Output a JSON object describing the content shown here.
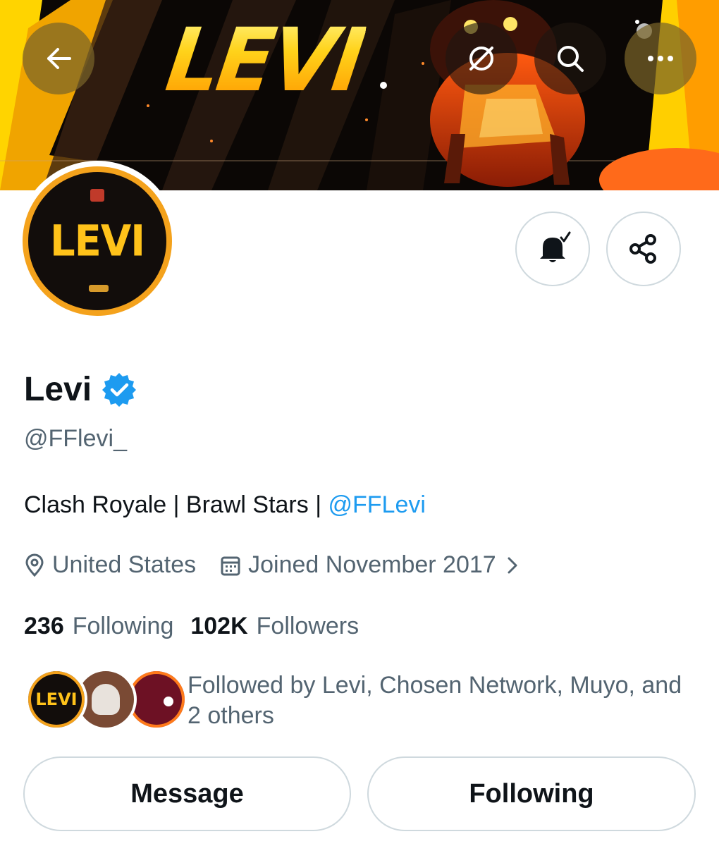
{
  "header": {
    "banner_text": "LEVI",
    "back_icon": "arrow-left-icon",
    "translate_icon": "globe-off-icon",
    "search_icon": "search-icon",
    "more_icon": "more-horizontal-icon"
  },
  "profile": {
    "avatar_text": "LEVI",
    "name": "Levi",
    "handle": "@FFlevi_",
    "bio_text": "Clash Royale | Brawl Stars | ",
    "bio_mention": "@FFLevi",
    "location": "United States",
    "joined": "Joined November 2017",
    "following_count": "236",
    "following_label": "Following",
    "followers_count": "102K",
    "followers_label": "Followers",
    "followed_by_text": "Followed by Levi, Chosen Network, Muyo, and 2 others",
    "followed_avatar_text": "LEVI"
  },
  "actions": {
    "message_label": "Message",
    "following_label": "Following"
  },
  "colors": {
    "accent": "#1d9bf0",
    "text_primary": "#0f1419",
    "text_secondary": "#536471",
    "border": "#cfd9de"
  }
}
